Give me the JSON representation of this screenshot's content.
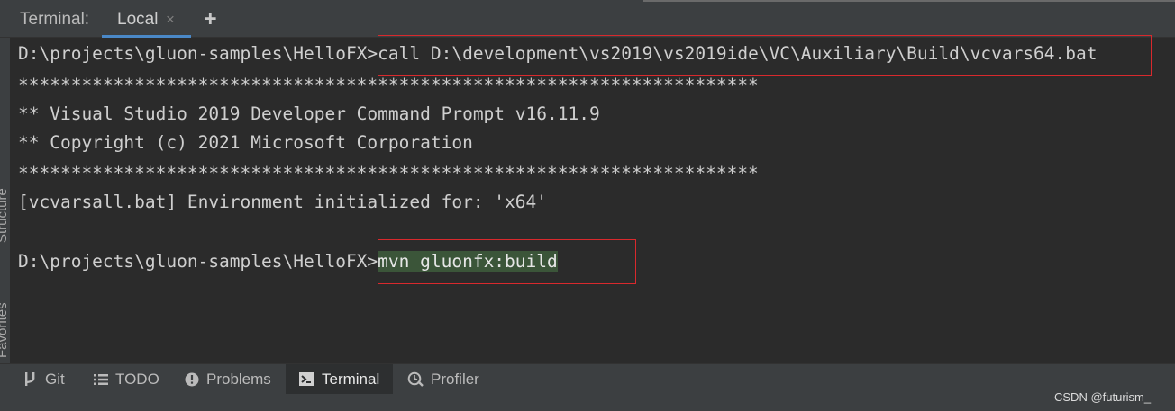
{
  "header": {
    "tool_label": "Terminal:",
    "tab_label": "Local",
    "close_glyph": "×",
    "add_glyph": "+"
  },
  "sidebar": {
    "structure_label": "Structure",
    "favorites_label": "Favorites"
  },
  "terminal": {
    "prompt": "D:\\projects\\gluon-samples\\HelloFX>",
    "command1": "call D:\\development\\vs2019\\vs2019ide\\VC\\Auxiliary\\Build\\vcvars64.bat",
    "separator": "**********************************************************************",
    "banner_line1": "** Visual Studio 2019 Developer Command Prompt v16.11.9",
    "banner_line2": "** Copyright (c) 2021 Microsoft Corporation",
    "env_line": "[vcvarsall.bat] Environment initialized for: 'x64'",
    "command2": "mvn gluonfx:build"
  },
  "bottom_bar": {
    "items": [
      {
        "label": "Git",
        "icon": "git-branch-icon"
      },
      {
        "label": "TODO",
        "icon": "list-icon"
      },
      {
        "label": "Problems",
        "icon": "problems-icon"
      },
      {
        "label": "Terminal",
        "icon": "terminal-icon",
        "active": true
      },
      {
        "label": "Profiler",
        "icon": "profiler-icon"
      }
    ]
  },
  "watermark": "CSDN @futurism_",
  "colors": {
    "background": "#2b2b2b",
    "panel": "#3c3f41",
    "tab_underline": "#4a88c7",
    "highlight_box": "#d9292d",
    "selection": "#3b5539"
  }
}
